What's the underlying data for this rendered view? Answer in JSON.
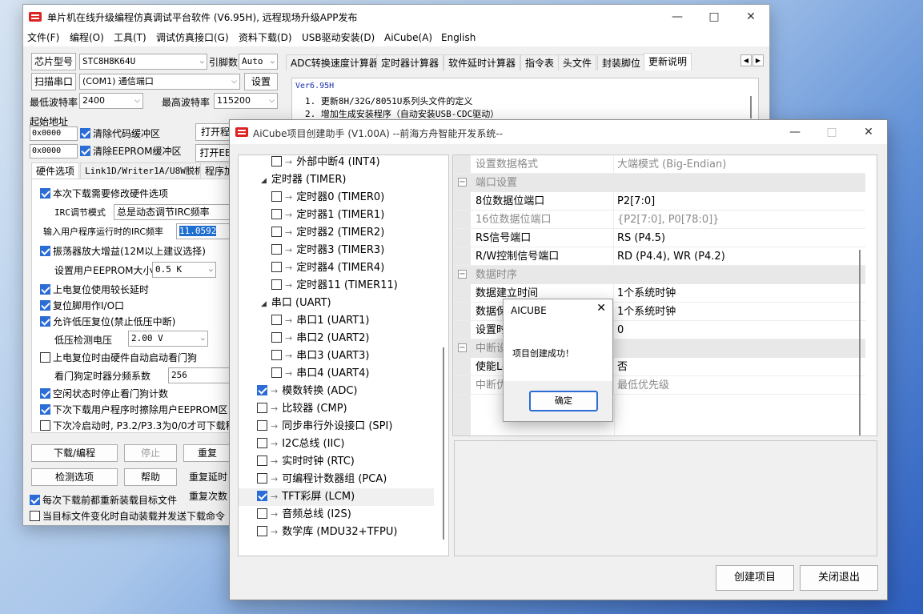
{
  "main": {
    "title": "单片机在线升级编程仿真调试平台软件 (V6.95H), 远程现场升级APP发布",
    "menu": [
      "文件(F)",
      "编程(O)",
      "工具(T)",
      "调试仿真接口(G)",
      "资料下载(D)",
      "USB驱动安装(D)",
      "AiCube(A)",
      "English"
    ],
    "chip_label": "芯片型号",
    "chip_value": "STC8H8K64U",
    "pins_label": "引脚数",
    "pins_value": "Auto",
    "scan_button": "扫描串口",
    "port_value": "(COM1) 通信端口",
    "settings_button": "设置",
    "min_baud_label": "最低波特率",
    "min_baud_value": "2400",
    "max_baud_label": "最高波特率",
    "max_baud_value": "115200",
    "start_addr_label": "起始地址",
    "addr1": "0x0000",
    "clear_code": "清除代码缓冲区",
    "open_prog": "打开程",
    "addr2": "0x0000",
    "clear_eeprom": "清除EEPROM缓冲区",
    "open_eeprom": "打开EE",
    "left_tabs": [
      "硬件选项",
      "Link1D/Writer1A/U8W脱机",
      "程序加"
    ],
    "opt_modify_hw": "本次下载需要修改硬件选项",
    "irc_mode_label": "IRC调节模式",
    "irc_mode_value": "总是动态调节IRC频率",
    "irc_freq_label": "输入用户程序运行时的IRC频率",
    "irc_freq_value": "11.0592",
    "opt_osc_gain": "振荡器放大增益(12M以上建议选择)",
    "eeprom_size_label": "设置用户EEPROM大小",
    "eeprom_size_value": "0.5 K",
    "opt_power_delay": "上电复位使用较长延时",
    "opt_reset_io": "复位脚用作I/O口",
    "opt_lvr": "允许低压复位(禁止低压中断)",
    "lv_label": "低压检测电压",
    "lv_value": "2.00 V",
    "opt_wdt": "上电复位时由硬件自动启动看门狗",
    "wdt_div_label": "看门狗定时器分频系数",
    "wdt_div_value": "256",
    "opt_idle_wdt": "空闲状态时停止看门狗计数",
    "opt_erase_eeprom": "下次下载用户程序时擦除用户EEPROM区",
    "opt_p32p33": "下次冷启动时, P3.2/P3.3为0/0才可下载程",
    "btn_download": "下载/编程",
    "btn_stop": "停止",
    "btn_repeat": "重复",
    "btn_check": "检测选项",
    "btn_help": "帮助",
    "repeat_delay": "重复延时",
    "repeat_count": "重复次数",
    "opt_reload": "每次下载前都重新装载目标文件",
    "opt_auto_load": "当目标文件变化时自动装载并发送下载命令",
    "right_tabs": [
      "ADC转换速度计算器",
      "定时器计算器",
      "软件延时计算器",
      "指令表",
      "头文件",
      "封装脚位",
      "更新说明"
    ],
    "notes": [
      "Ver6.95H",
      "1. 更新8H/32G/8051U系列头文件的定义",
      "2. 增加生成安装程序（自动安装USB-CDC驱动）"
    ]
  },
  "aicube": {
    "title": "AiCube项目创建助手 (V1.00A) --前海方舟智能开发系统--",
    "tree": [
      {
        "label": "外部中断4 (INT4)",
        "checked": false,
        "level": 2
      },
      {
        "label": "定时器 (TIMER)",
        "level": 1,
        "expanded": true
      },
      {
        "label": "定时器0 (TIMER0)",
        "checked": false,
        "level": 2
      },
      {
        "label": "定时器1 (TIMER1)",
        "checked": false,
        "level": 2
      },
      {
        "label": "定时器2 (TIMER2)",
        "checked": false,
        "level": 2
      },
      {
        "label": "定时器3 (TIMER3)",
        "checked": false,
        "level": 2
      },
      {
        "label": "定时器4 (TIMER4)",
        "checked": false,
        "level": 2
      },
      {
        "label": "定时器11 (TIMER11)",
        "checked": false,
        "level": 2
      },
      {
        "label": "串口 (UART)",
        "level": 1,
        "expanded": true
      },
      {
        "label": "串口1 (UART1)",
        "checked": false,
        "level": 2
      },
      {
        "label": "串口2 (UART2)",
        "checked": false,
        "level": 2
      },
      {
        "label": "串口3 (UART3)",
        "checked": false,
        "level": 2
      },
      {
        "label": "串口4 (UART4)",
        "checked": false,
        "level": 2
      },
      {
        "label": "模数转换 (ADC)",
        "checked": true,
        "level": 1
      },
      {
        "label": "比较器 (CMP)",
        "checked": false,
        "level": 1
      },
      {
        "label": "同步串行外设接口 (SPI)",
        "checked": false,
        "level": 1
      },
      {
        "label": "I2C总线 (IIC)",
        "checked": false,
        "level": 1
      },
      {
        "label": "实时时钟 (RTC)",
        "checked": false,
        "level": 1
      },
      {
        "label": "可编程计数器组 (PCA)",
        "checked": false,
        "level": 1
      },
      {
        "label": "TFT彩屏 (LCM)",
        "checked": true,
        "level": 1,
        "selected": true
      },
      {
        "label": "音频总线 (I2S)",
        "checked": false,
        "level": 1
      },
      {
        "label": "数学库 (MDU32+TFPU)",
        "checked": false,
        "level": 1
      }
    ],
    "props": [
      {
        "key": "设置数据格式",
        "value": "大端模式 (Big-Endian)",
        "style": "gray"
      },
      {
        "key": "端口设置",
        "style": "cat"
      },
      {
        "key": "8位数据位端口",
        "value": "P2[7:0]"
      },
      {
        "key": "16位数据位端口",
        "value": "{P2[7:0], P0[78:0]}",
        "style": "gray"
      },
      {
        "key": "RS信号端口",
        "value": "RS (P4.5)"
      },
      {
        "key": "R/W控制信号端口",
        "value": "RD (P4.4), WR (P4.2)"
      },
      {
        "key": "数据时序",
        "style": "cat"
      },
      {
        "key": "数据建立时间",
        "value": "1个系统时钟"
      },
      {
        "key": "数据保",
        "value": "1个系统时钟"
      },
      {
        "key": "设置时",
        "value": "0"
      },
      {
        "key": "中断设",
        "style": "cat"
      },
      {
        "key": "使能Lo",
        "value": "否"
      },
      {
        "key": "中断优",
        "value": "最低优先级",
        "style": "gray"
      }
    ],
    "create_button": "创建项目",
    "close_button": "关闭退出"
  },
  "msgbox": {
    "title": "AICUBE",
    "message": "项目创建成功！",
    "ok": "确定"
  }
}
